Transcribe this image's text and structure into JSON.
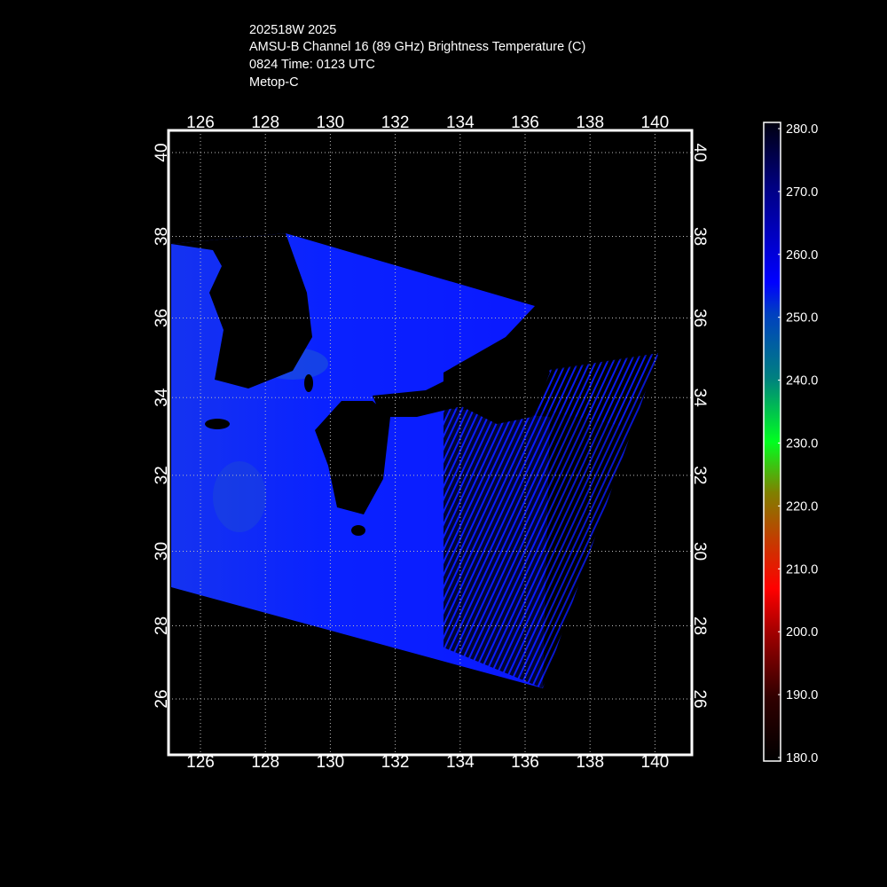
{
  "header": {
    "line1": "202518W 2025",
    "line2": "AMSU-B Channel 16 (89 GHz) Brightness Temperature (C)",
    "line3": "0824 Time: 0123 UTC",
    "line4": "Metop-C"
  },
  "chart_data": {
    "type": "heatmap",
    "title": "AMSU-B Channel 16 (89 GHz) Brightness Temperature (C)",
    "storm_id": "202518W 2025",
    "satellite": "Metop-C",
    "lon_ticks": [
      "126",
      "128",
      "130",
      "132",
      "134",
      "136",
      "138",
      "140"
    ],
    "lat_ticks": [
      "40",
      "38",
      "36",
      "34",
      "32",
      "30",
      "28",
      "26"
    ],
    "lon_range": [
      125,
      141
    ],
    "lat_range": [
      25,
      40.5
    ],
    "grid": true,
    "colorbar": {
      "placement": "right",
      "range": [
        180,
        280
      ],
      "ticks": [
        "280.0",
        "270.0",
        "260.0",
        "250.0",
        "240.0",
        "230.0",
        "220.0",
        "210.0",
        "200.0",
        "190.0",
        "180.0"
      ]
    },
    "colors": {
      "swath": "#0a1cff",
      "land": "#000000",
      "background": "#000000"
    }
  }
}
